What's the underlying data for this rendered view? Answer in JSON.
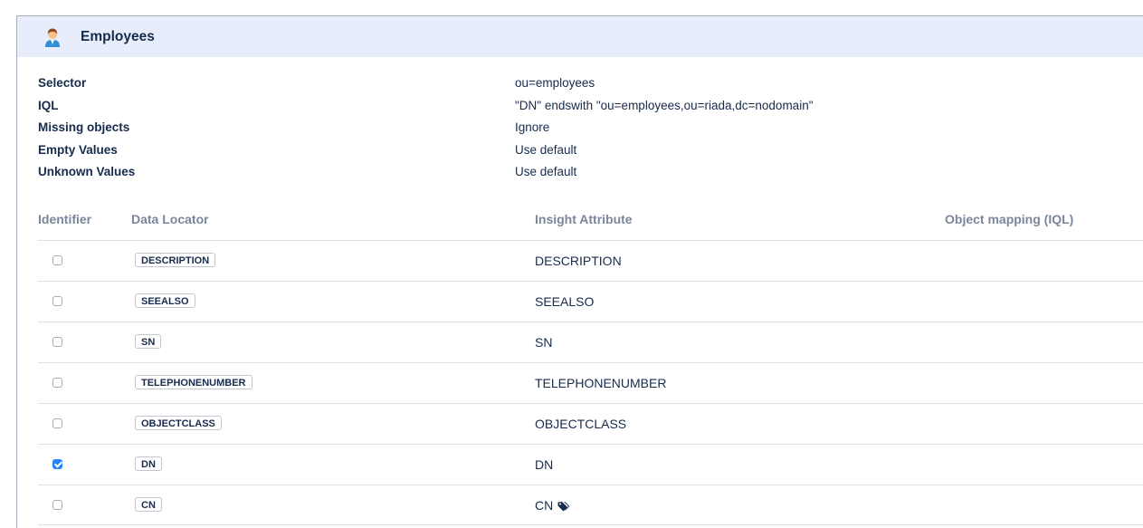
{
  "panel": {
    "title": "Employees",
    "icon": "user-avatar-icon"
  },
  "properties": [
    {
      "label": "Selector",
      "value": "ou=employees"
    },
    {
      "label": "IQL",
      "value": "\"DN\" endswith \"ou=employees,ou=riada,dc=nodomain\""
    },
    {
      "label": "Missing objects",
      "value": "Ignore"
    },
    {
      "label": "Empty Values",
      "value": "Use default"
    },
    {
      "label": "Unknown Values",
      "value": "Use default"
    }
  ],
  "table": {
    "headers": {
      "identifier": "Identifier",
      "data_locator": "Data Locator",
      "insight_attribute": "Insight Attribute",
      "object_mapping": "Object mapping (IQL)"
    },
    "rows": [
      {
        "locator": "DESCRIPTION",
        "attribute": "DESCRIPTION",
        "identifier": false
      },
      {
        "locator": "SEEALSO",
        "attribute": "SEEALSO",
        "identifier": false
      },
      {
        "locator": "SN",
        "attribute": "SN",
        "identifier": false
      },
      {
        "locator": "TELEPHONENUMBER",
        "attribute": "TELEPHONENUMBER",
        "identifier": false
      },
      {
        "locator": "OBJECTCLASS",
        "attribute": "OBJECTCLASS",
        "identifier": false
      },
      {
        "locator": "DN",
        "attribute": "DN",
        "identifier": true
      },
      {
        "locator": "CN",
        "attribute": "CN",
        "identifier": false,
        "label_icon": "label-tag-icon"
      }
    ]
  },
  "colors": {
    "header_bg": "#e8edfb",
    "checkbox_checked": "#2684ff",
    "muted_header": "#7a869a"
  }
}
